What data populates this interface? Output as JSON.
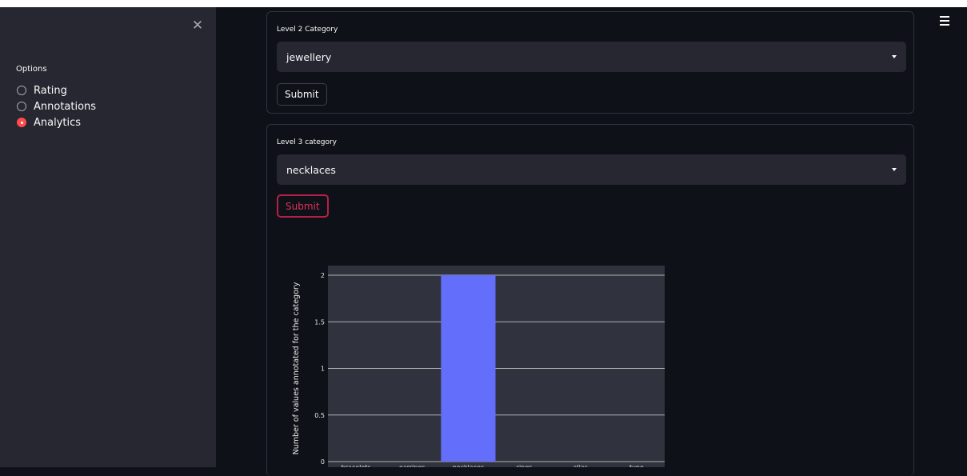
{
  "sidebar": {
    "close_glyph": "✕",
    "options_label": "Options",
    "radio_options": [
      "Rating",
      "Annotations",
      "Analytics"
    ],
    "selected": "Analytics"
  },
  "level2": {
    "label": "Level 2 Category",
    "selected": "jewellery",
    "submit_label": "Submit"
  },
  "level3": {
    "label": "Level 3 category",
    "selected": "necklaces",
    "submit_label": "Submit"
  },
  "colors": {
    "accent": "#ff4b4b",
    "bar": "#636efa",
    "plot_bg": "#30323d",
    "background": "#0e1117",
    "sidebar": "#262730"
  },
  "chart_data": {
    "type": "bar",
    "categories": [
      "bracelets",
      "earrings",
      "necklaces",
      "rings",
      "alias",
      "type"
    ],
    "values": [
      0,
      0,
      2,
      0,
      0,
      0
    ],
    "ylabel": "Number of values annotated for the category",
    "xlabel": "",
    "ylim": [
      0,
      2
    ],
    "yticks": [
      0,
      0.5,
      1,
      1.5,
      2
    ],
    "ytick_labels": [
      "0",
      "0.5",
      "1",
      "1.5",
      "2"
    ],
    "grid": true
  }
}
